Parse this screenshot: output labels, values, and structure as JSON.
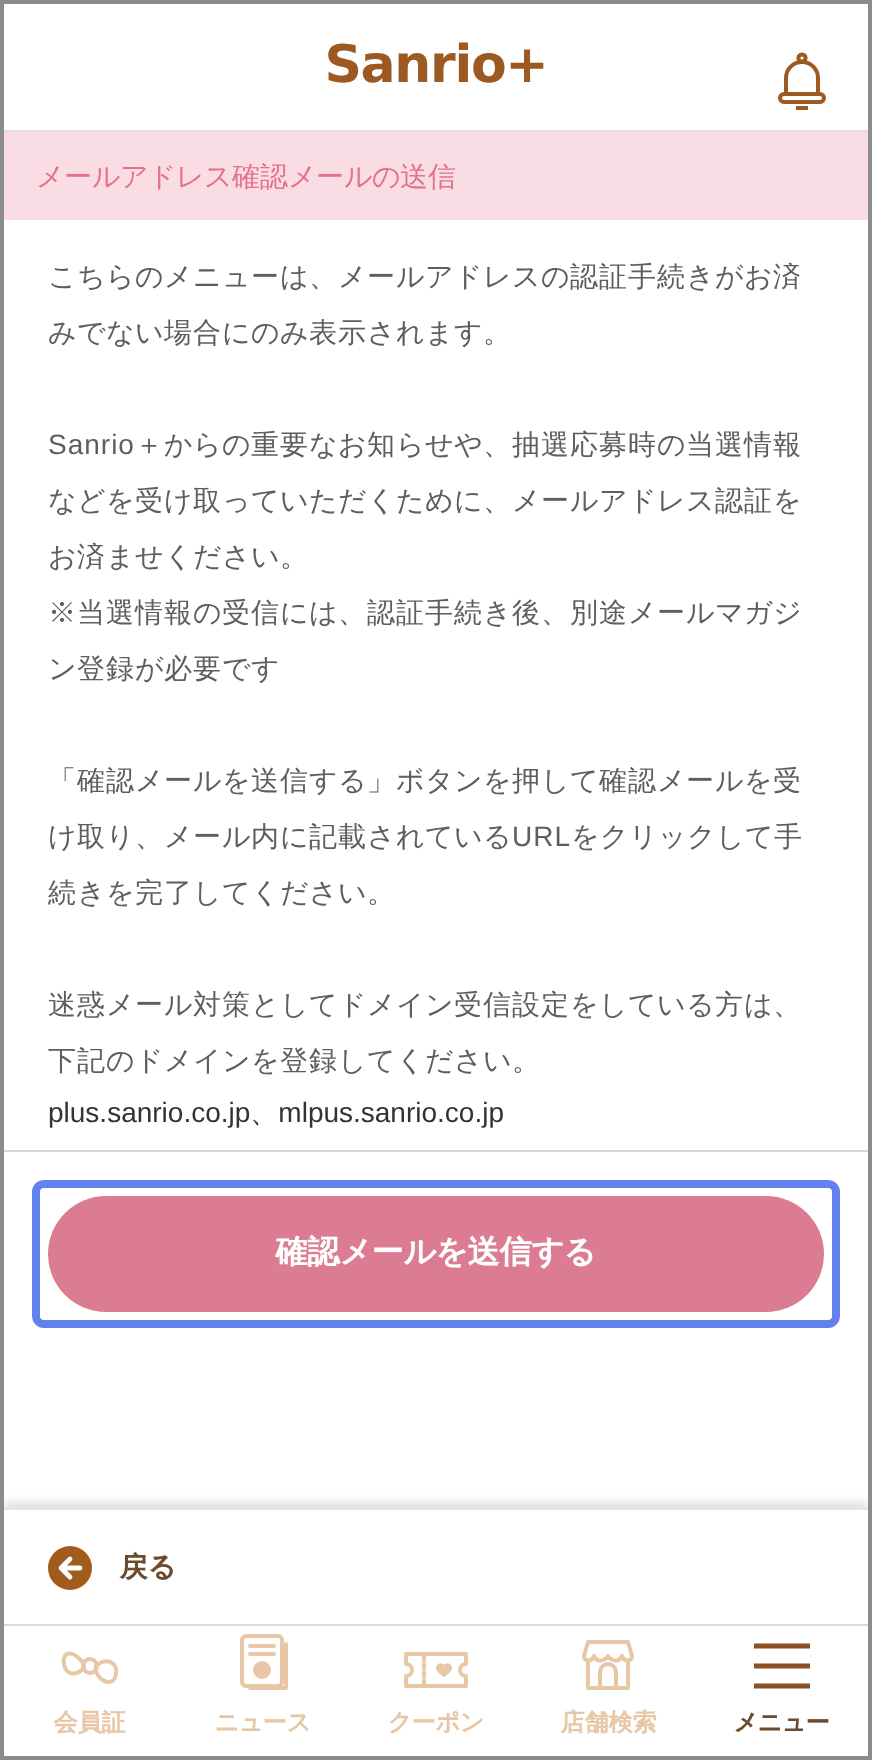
{
  "header": {
    "logo": "Sanrio+"
  },
  "banner": {
    "title": "メールアドレス確認メールの送信"
  },
  "paragraphs": [
    {
      "lines": [
        "こちらのメニューは、メールアドレスの認証手続きがお済みでない場合にのみ表示されます。"
      ]
    },
    {
      "lines": [
        "Sanrio＋からの重要なお知らせや、抽選応募時の当選情報などを受け取っていただくために、メールアドレス認証をお済ませください。",
        "※当選情報の受信には、認証手続き後、別途メールマガジン登録が必要です"
      ]
    },
    {
      "lines": [
        "「確認メールを送信する」ボタンを押して確認メールを受け取り、メール内に記載されているURLをクリックして手続きを完了してください。"
      ]
    },
    {
      "lines": [
        "迷惑メール対策としてドメイン受信設定をしている方は、下記のドメインを登録してください。"
      ]
    }
  ],
  "domains": "plus.sanrio.co.jp、mlpus.sanrio.co.jp",
  "send_button": {
    "label": "確認メールを送信する",
    "focused": true
  },
  "back": {
    "label": "戻る"
  },
  "nav": [
    {
      "kind": "ribbon",
      "label": "会員証",
      "selected": false
    },
    {
      "kind": "news",
      "label": "ニュース",
      "selected": false
    },
    {
      "kind": "coupon",
      "label": "クーポン",
      "selected": false
    },
    {
      "kind": "store",
      "label": "店舗検索",
      "selected": false
    },
    {
      "kind": "menu",
      "label": "メニュー",
      "selected": true
    }
  ]
}
